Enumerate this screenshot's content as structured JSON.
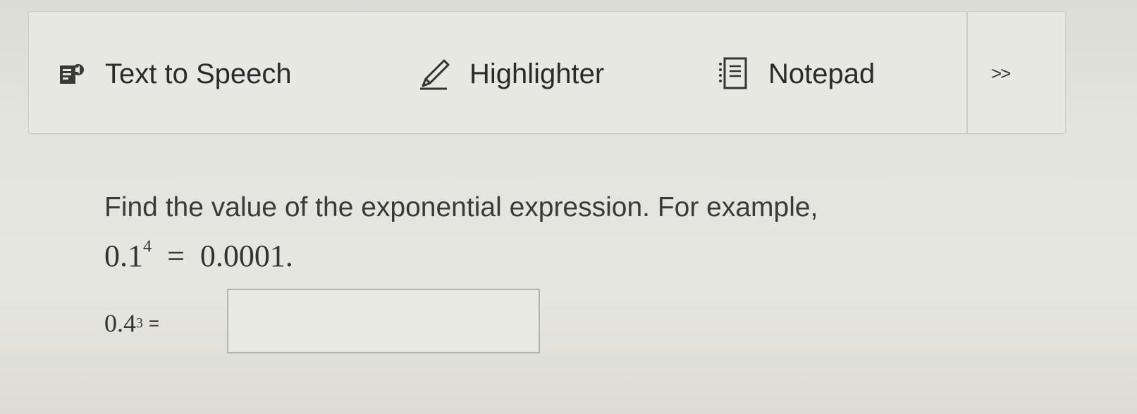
{
  "toolbar": {
    "text_to_speech_label": "Text to Speech",
    "highlighter_label": "Highlighter",
    "notepad_label": "Notepad",
    "more_label": ">>",
    "icons": {
      "text_to_speech": "speaker-page-icon",
      "highlighter": "pen-icon",
      "notepad": "notepad-icon"
    }
  },
  "question": {
    "instruction": "Find the value of the exponential expression. For example,",
    "example": {
      "base": "0.1",
      "exponent": "4",
      "equals": "=",
      "result": "0.0001."
    },
    "problem": {
      "base": "0.4",
      "exponent": "3",
      "equals": "=",
      "answer_value": ""
    }
  }
}
